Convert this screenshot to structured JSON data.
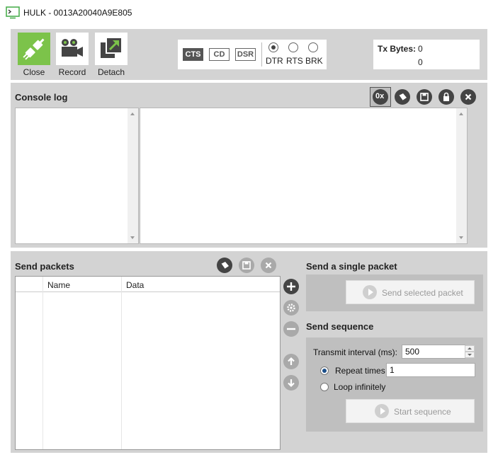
{
  "window": {
    "title": "HULK - 0013A20040A9E805",
    "icon": "terminal-icon"
  },
  "toolbar": {
    "close_label": "Close",
    "record_label": "Record",
    "detach_label": "Detach",
    "lines": {
      "cts": {
        "label": "CTS",
        "active": true
      },
      "cd": {
        "label": "CD",
        "active": false
      },
      "dsr": {
        "label": "DSR",
        "active": false
      },
      "dtr": {
        "label": "DTR",
        "checked": true
      },
      "rts": {
        "label": "RTS",
        "checked": false
      },
      "brk": {
        "label": "BRK",
        "checked": false
      }
    },
    "tx_label": "Tx Bytes:",
    "tx_value": "0",
    "rx_value": "0"
  },
  "console": {
    "title": "Console log",
    "icons": [
      "hex-icon",
      "eraser-icon",
      "save-icon",
      "lock-icon",
      "close-icon"
    ],
    "hex_label": "0x"
  },
  "send_packets": {
    "title": "Send packets",
    "columns": [
      "Name",
      "Data"
    ],
    "rows": []
  },
  "single_packet": {
    "title": "Send a single packet",
    "button_label": "Send selected packet"
  },
  "sequence": {
    "title": "Send sequence",
    "interval_label": "Transmit interval (ms):",
    "interval_value": "500",
    "repeat_label": "Repeat times",
    "repeat_value": "1",
    "repeat_selected": true,
    "loop_label": "Loop infinitely",
    "start_label": "Start sequence"
  },
  "colors": {
    "panel_bg": "#d3d3d3",
    "accent_green": "#7cc34a",
    "icon_dark": "#444444"
  }
}
